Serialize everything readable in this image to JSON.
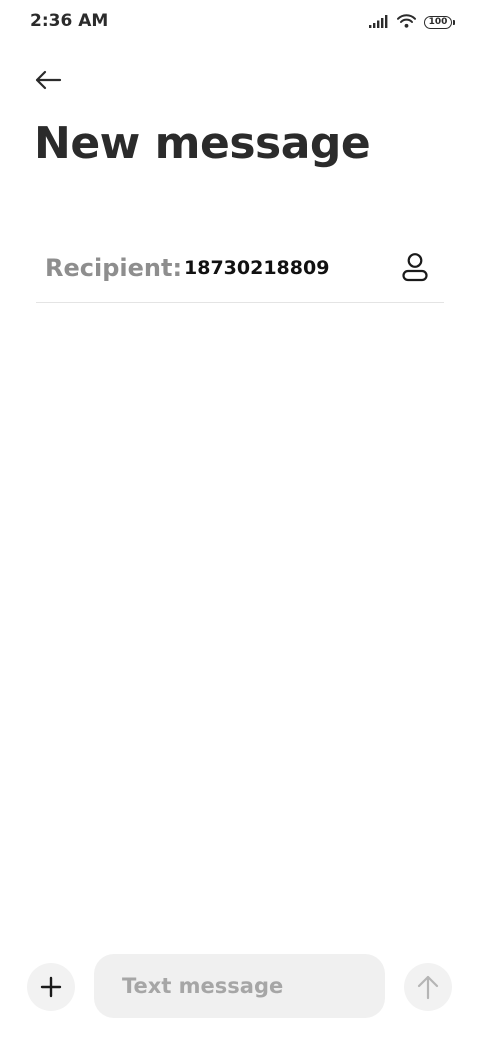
{
  "status_bar": {
    "time": "2:36 AM",
    "battery_level": "100",
    "icons": [
      "signal-icon",
      "wifi-icon",
      "battery-icon"
    ]
  },
  "header": {
    "back_icon": "arrow-left-icon",
    "title": "New message"
  },
  "recipient": {
    "label": "Recipient:",
    "value": "18730218809",
    "contact_icon": "person-icon"
  },
  "composer": {
    "attach_icon": "plus-icon",
    "placeholder": "Text message",
    "value": "",
    "send_icon": "arrow-up-icon"
  },
  "colors": {
    "text": "#2b2b2b",
    "label_gray": "#8e8e8e",
    "input_bg": "#f0f0f0",
    "button_bg": "#f2f2f2",
    "send_disabled": "#b5b5b5",
    "divider": "#e4e4e4"
  }
}
